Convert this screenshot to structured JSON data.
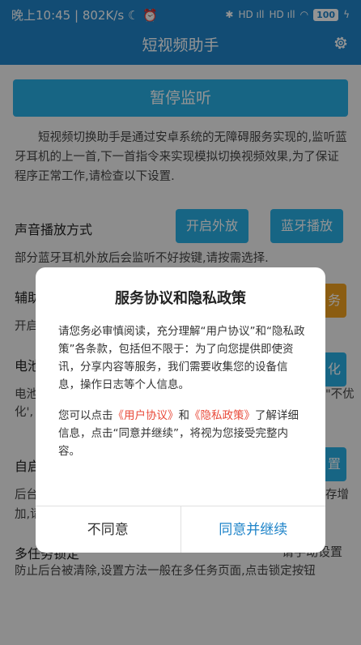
{
  "status": {
    "time": "晚上10:45",
    "speed": "802K/s",
    "bt": "✱",
    "signal1": "HD ıll",
    "signal2": "HD ıll",
    "wifi": "◠",
    "battery": "100",
    "charge": "ϟ"
  },
  "app": {
    "title": "短视频助手"
  },
  "main": {
    "pause_label": "暂停监听",
    "intro": "短视频切换助手是通过安卓系统的无障碍服务实现的,监听蓝牙耳机的上一首,下一首指令来实现模拟切换视频效果,为了保证程序正常工作,请检查以下设置.",
    "sound": {
      "title": "声音播放方式",
      "btn_speaker": "开启外放",
      "btn_bt": "蓝牙播放",
      "desc": "部分蓝牙耳机外放后会监听不好按键,请按需选择."
    },
    "accessibility": {
      "title": "辅助",
      "desc": "开启",
      "btn": "务"
    },
    "battery": {
      "title": "电池",
      "desc1": "电池",
      "desc2": "化',",
      "desc_right": "\"不优",
      "btn": "化"
    },
    "autostart": {
      "title": "自启",
      "desc1": "后台",
      "desc2": "加,请",
      "desc_right": "存增",
      "btn": "置"
    },
    "multitask": {
      "title": "多任务锁定",
      "right_label": "请手动设置",
      "desc": "防止后台被清除,设置方法一般在多任务页面,点击锁定按钮"
    }
  },
  "dialog": {
    "title": "服务协议和隐私政策",
    "p1": "请您务必审慎阅读，充分理解“用户协议”和“隐私政策”各条款，包括但不限于：为了向您提供即使资讯，分享内容等服务，我们需要收集您的设备信息，操作日志等个人信息。",
    "p2_prefix": "您可以点击",
    "p2_link1": "《用户协议》",
    "p2_and": "和",
    "p2_link2": "《隐私政策》",
    "p2_suffix": "了解详细信息，点击“同意并继续”，将视为您接受完整内容。",
    "disagree": "不同意",
    "agree": "同意并继续"
  },
  "colors": {
    "primary": "#1f84c9",
    "button": "#29aee4",
    "accent": "#f0a020",
    "link": "#e94a3a"
  }
}
